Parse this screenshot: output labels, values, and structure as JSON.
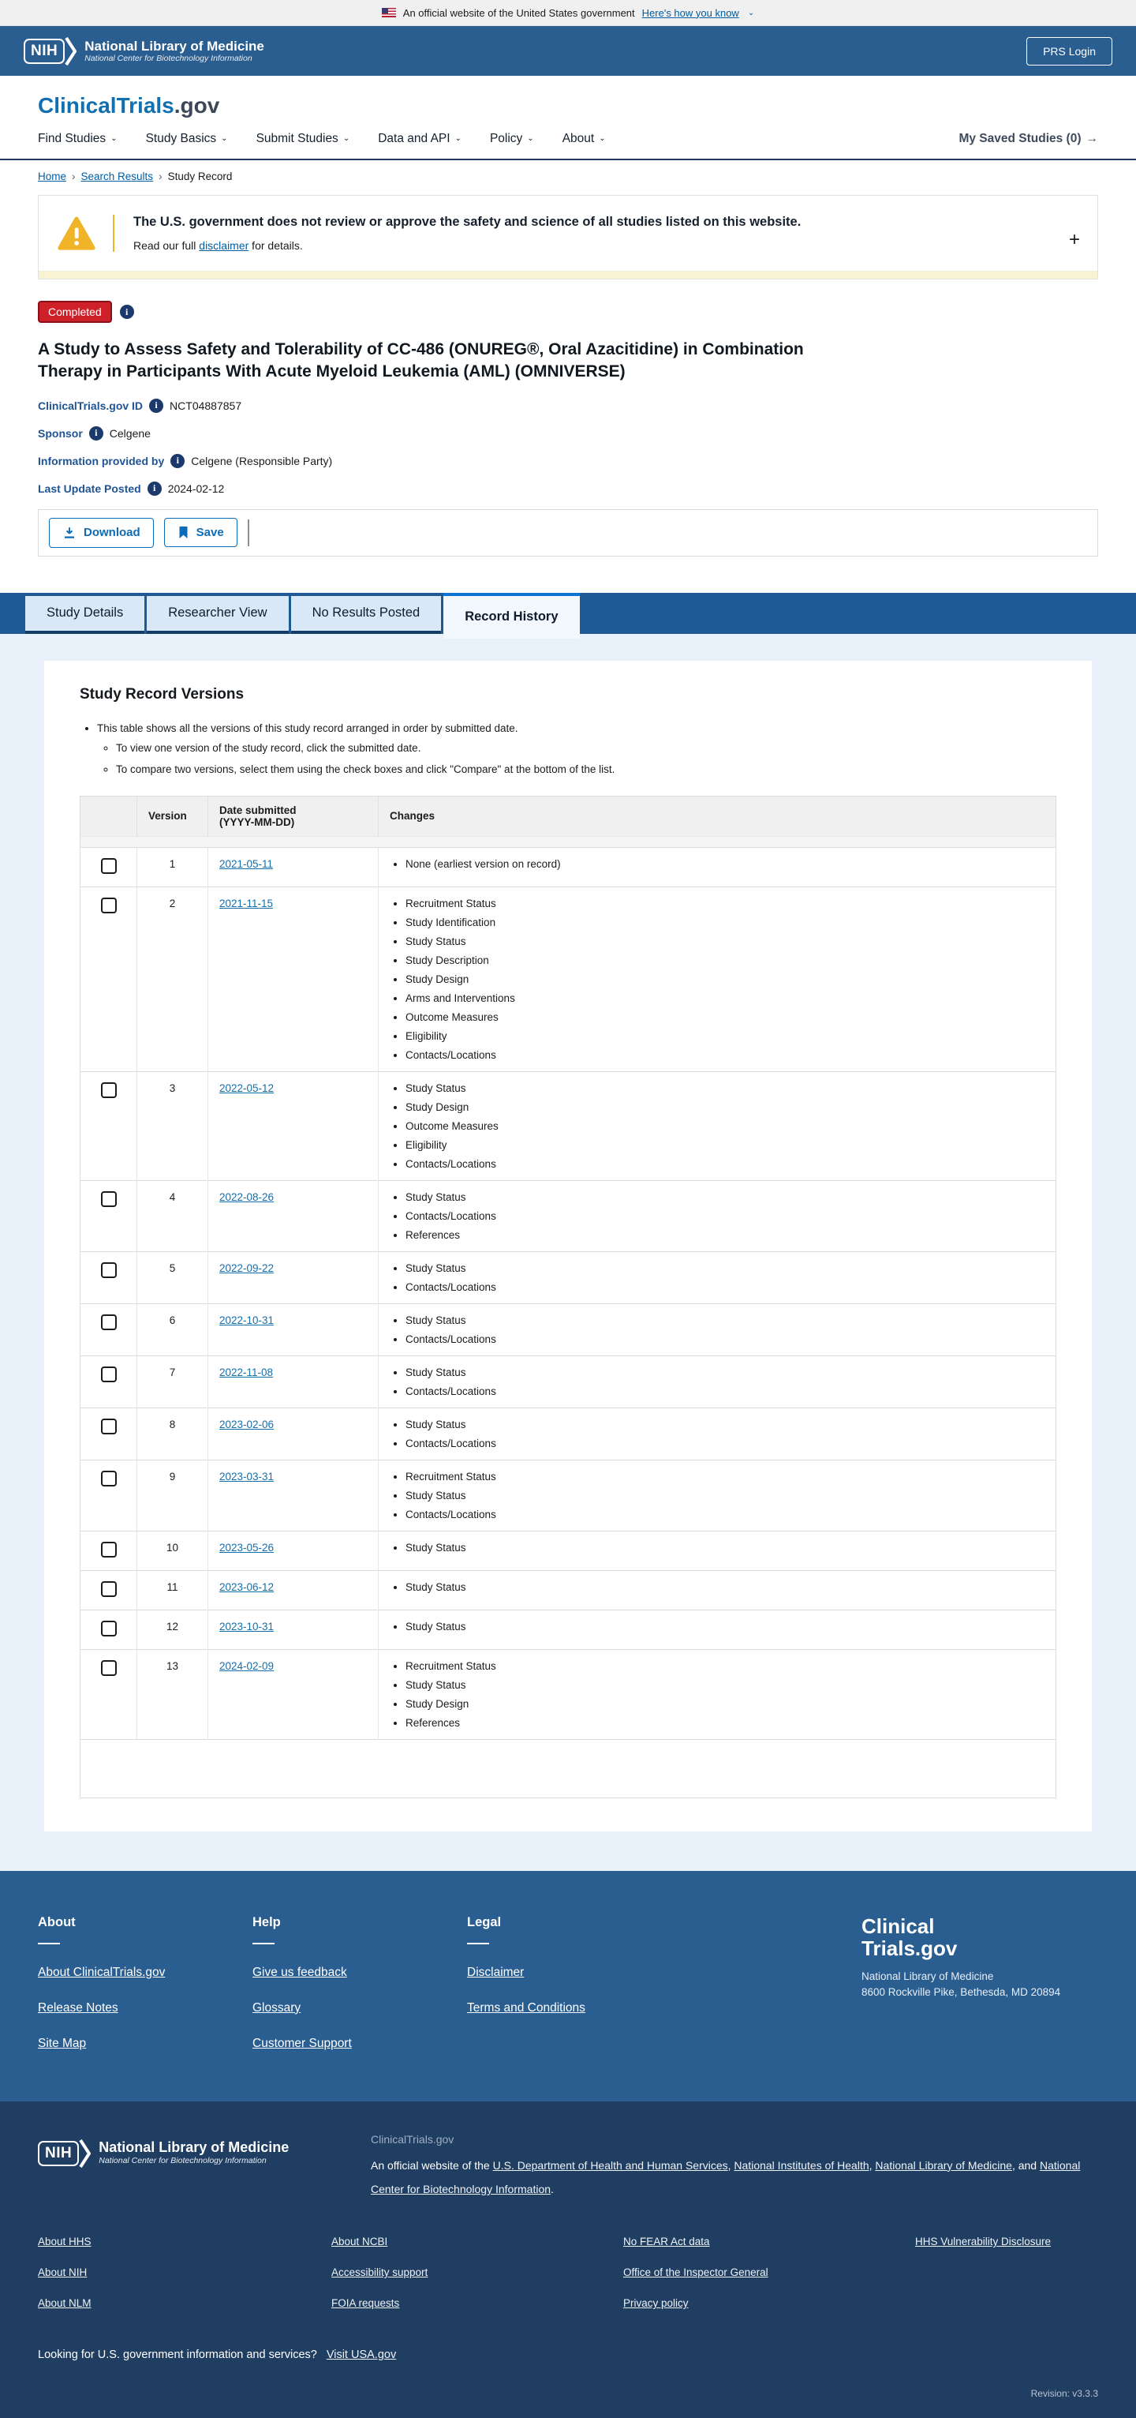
{
  "colors": {
    "header_blue": "#2a5e90",
    "band_blue": "#1e5a96",
    "accent_blue": "#0d6cb7",
    "link_blue": "#005ea2",
    "status_red": "#ce2029",
    "warning_amber": "#f0b429",
    "footer_dark": "#203e61",
    "content_bg": "#e9f2fb",
    "inactive_tab": "#d9e8f6"
  },
  "gov_banner": {
    "text": "An official website of the United States government",
    "link": "Here's how you know"
  },
  "nih_header": {
    "logo": "NIH",
    "org": "National Library of Medicine",
    "suborg": "National Center for Biotechnology Information",
    "login_button": "PRS Login"
  },
  "site": {
    "brand_primary": "ClinicalTrials",
    "brand_suffix": ".gov",
    "nav": [
      "Find Studies",
      "Study Basics",
      "Submit Studies",
      "Data and API",
      "Policy",
      "About"
    ],
    "saved_studies": "My Saved Studies (0)",
    "saved_arrow": "→"
  },
  "breadcrumb": [
    {
      "label": "Home",
      "is_link": true
    },
    {
      "label": "Search Results",
      "is_link": true
    },
    {
      "label": "Study Record",
      "is_link": false
    }
  ],
  "disclaimer": {
    "title": "The U.S. government does not review or approve the safety and science of all studies listed on this website.",
    "body_prefix": "Read our full ",
    "link": "disclaimer",
    "body_suffix": " for details.",
    "expand": "+"
  },
  "study": {
    "status": "Completed",
    "title": "A Study to Assess Safety and Tolerability of CC-486 (ONUREG®, Oral Azacitidine) in Combination Therapy in Participants With Acute Myeloid Leukemia (AML) (OMNIVERSE)",
    "fields": [
      {
        "label": "ClinicalTrials.gov ID",
        "value": "NCT04887857"
      },
      {
        "label": "Sponsor",
        "value": "Celgene"
      },
      {
        "label": "Information provided by",
        "value": "Celgene (Responsible Party)"
      },
      {
        "label": "Last Update Posted",
        "value": "2024-02-12"
      }
    ]
  },
  "toolbar": {
    "download_label": "Download",
    "save_label": "Save"
  },
  "tabs": [
    {
      "label": "Study Details",
      "active": false
    },
    {
      "label": "Researcher View",
      "active": false
    },
    {
      "label": "No Results Posted",
      "active": false
    },
    {
      "label": "Record History",
      "active": true
    }
  ],
  "record_versions": {
    "heading": "Study Record Versions",
    "note": "This table shows all the versions of this study record arranged in order by submitted date.",
    "subnotes": [
      "To view one version of the study record, click the submitted date.",
      "To compare two versions, select them using the check boxes and click \"Compare\" at the bottom of the list."
    ],
    "table": {
      "headers": {
        "version": "Version",
        "date": "Date submitted",
        "date_sub": "(YYYY-MM-DD)",
        "changes": "Changes"
      },
      "rows": [
        {
          "version": "1",
          "date": "2021-05-11",
          "changes": [
            "None (earliest version on record)"
          ]
        },
        {
          "version": "2",
          "date": "2021-11-15",
          "changes": [
            "Recruitment Status",
            "Study Identification",
            "Study Status",
            "Study Description",
            "Study Design",
            "Arms and Interventions",
            "Outcome Measures",
            "Eligibility",
            "Contacts/Locations"
          ]
        },
        {
          "version": "3",
          "date": "2022-05-12",
          "changes": [
            "Study Status",
            "Study Design",
            "Outcome Measures",
            "Eligibility",
            "Contacts/Locations"
          ]
        },
        {
          "version": "4",
          "date": "2022-08-26",
          "changes": [
            "Study Status",
            "Contacts/Locations",
            "References"
          ]
        },
        {
          "version": "5",
          "date": "2022-09-22",
          "changes": [
            "Study Status",
            "Contacts/Locations"
          ]
        },
        {
          "version": "6",
          "date": "2022-10-31",
          "changes": [
            "Study Status",
            "Contacts/Locations"
          ]
        },
        {
          "version": "7",
          "date": "2022-11-08",
          "changes": [
            "Study Status",
            "Contacts/Locations"
          ]
        },
        {
          "version": "8",
          "date": "2023-02-06",
          "changes": [
            "Study Status",
            "Contacts/Locations"
          ]
        },
        {
          "version": "9",
          "date": "2023-03-31",
          "changes": [
            "Recruitment Status",
            "Study Status",
            "Contacts/Locations"
          ]
        },
        {
          "version": "10",
          "date": "2023-05-26",
          "changes": [
            "Study Status"
          ]
        },
        {
          "version": "11",
          "date": "2023-06-12",
          "changes": [
            "Study Status"
          ]
        },
        {
          "version": "12",
          "date": "2023-10-31",
          "changes": [
            "Study Status"
          ]
        },
        {
          "version": "13",
          "date": "2024-02-09",
          "changes": [
            "Recruitment Status",
            "Study Status",
            "Study Design",
            "References"
          ]
        }
      ]
    }
  },
  "footer": {
    "columns": [
      {
        "heading": "About",
        "links": [
          "About ClinicalTrials.gov",
          "Release Notes",
          "Site Map"
        ]
      },
      {
        "heading": "Help",
        "links": [
          "Give us feedback",
          "Glossary",
          "Customer Support"
        ]
      },
      {
        "heading": "Legal",
        "links": [
          "Disclaimer",
          "Terms and Conditions"
        ]
      }
    ],
    "brand": {
      "line1": "Clinical",
      "line2": "Trials.gov",
      "org": "National Library of Medicine",
      "address": "8600 Rockville Pike, Bethesda, MD 20894"
    }
  },
  "subfooter": {
    "nih_logo": "NIH",
    "org": "National Library of Medicine",
    "suborg": "National Center for Biotechnology Information",
    "site": "ClinicalTrials.gov",
    "official_prefix": "An official website of the ",
    "official_links": [
      "U.S. Department of Health and Human Services",
      "National Institutes of Health",
      "National Library of Medicine",
      "National Center for Biotechnology Information"
    ],
    "link_columns": [
      [
        "About HHS",
        "About NIH",
        "About NLM"
      ],
      [
        "About NCBI",
        "Accessibility support",
        "FOIA requests"
      ],
      [
        "No FEAR Act data",
        "Office of the Inspector General",
        "Privacy policy"
      ],
      [
        "HHS Vulnerability Disclosure"
      ]
    ],
    "usa_text": "Looking for U.S. government information and services?",
    "usa_link": "Visit USA.gov",
    "revision": "Revision: v3.3.3"
  }
}
